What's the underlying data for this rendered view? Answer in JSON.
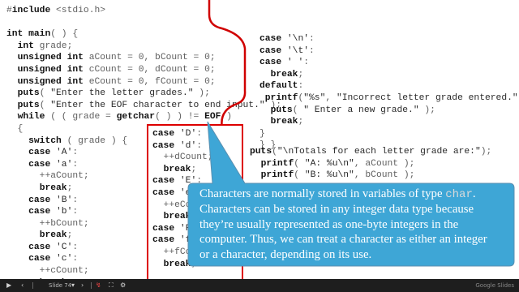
{
  "slide": {
    "code_left": [
      "#include <stdio.h>",
      "",
      "int main( ) {",
      "  int grade;",
      "  unsigned int aCount = 0, bCount = 0;",
      "  unsigned int cCount = 0, dCount = 0;",
      "  unsigned int eCount = 0, fCount = 0;",
      "  puts( \"Enter the letter grades.\" );",
      "  puts( \"Enter the EOF character to end input.\" );",
      "  while ( ( grade = getchar( ) ) != EOF )",
      "  {",
      "    switch ( grade ) {",
      "    case 'A':",
      "    case 'a':",
      "      ++aCount;",
      "      break;",
      "    case 'B':",
      "    case 'b':",
      "      ++bCount;",
      "      break;",
      "    case 'C':",
      "    case 'c':",
      "      ++cCount;",
      "      break;"
    ],
    "code_inner": [
      "case 'D':",
      "case 'd':",
      "  ++dCount;",
      "  break;",
      "case 'E':",
      "case 'e':",
      "  ++eCount;",
      "  break;",
      "case 'F':",
      "case 'f':",
      "  ++fCount;",
      "  break;"
    ],
    "code_right": [
      "case '\\n':",
      "case '\\t':",
      "case ' ':",
      "  break;",
      "default:",
      " printf(\"%s\", \"Incorrect letter grade entered.\");",
      "  puts( \" Enter a new grade.\" );",
      "  break;",
      "}",
      "} }"
    ],
    "code_bottom": [
      "puts(\"\\nTotals for each letter grade are:\");",
      "  printf( \"A: %u\\n\", aCount );",
      "  printf( \"B: %u\\n\", bCount );"
    ],
    "callout": {
      "before": "Characters are normally stored in variables of type ",
      "code": "char",
      "after": ". Characters can be stored in any integer data type because they’re usually represented as one-byte integers in the computer. Thus, we can treat a character as either an integer or a character, depending on its use."
    }
  },
  "player": {
    "slide_indicator": "Slide 74",
    "brand": "Google Slides"
  },
  "colors": {
    "divider": "#d00000",
    "callout_fill": "#3ea6d6",
    "control_bar": "#1e1e1e"
  }
}
